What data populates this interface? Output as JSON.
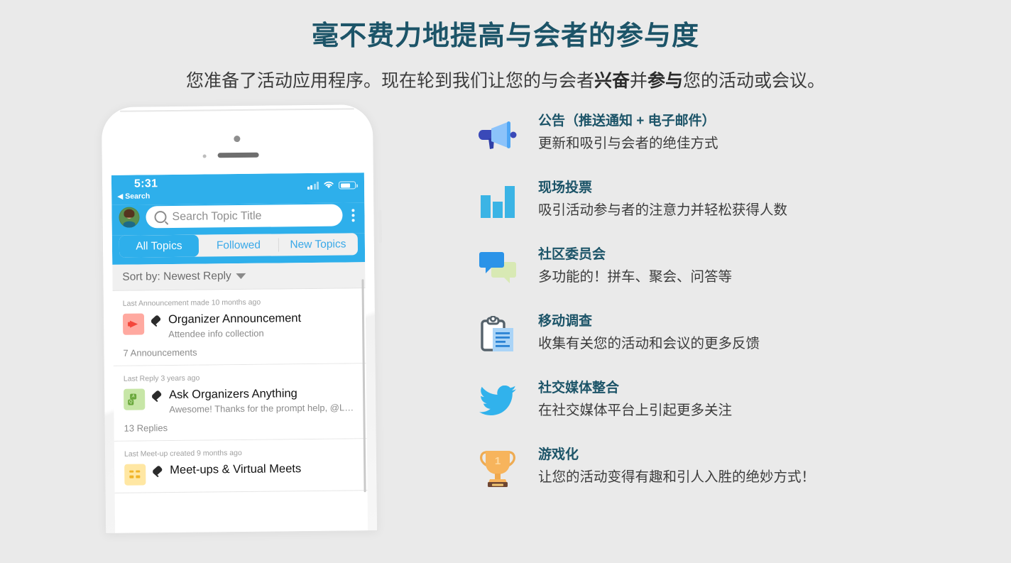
{
  "header": {
    "title": "毫不费力地提高与会者的参与度",
    "subtitle_part1": "您准备了活动应用程序。现在轮到我们让您的与会者",
    "subtitle_bold1": "兴奋",
    "subtitle_part2": "并",
    "subtitle_bold2": "参与",
    "subtitle_part3": "您的活动或会议。",
    "title_color": "#1c5468"
  },
  "phone": {
    "status": {
      "time": "5:31",
      "back_label": "◀ Search",
      "signal_icon": "signal-bars-icon",
      "wifi_icon": "wifi-icon",
      "battery_icon": "battery-icon"
    },
    "nav": {
      "avatar_name": "user-avatar",
      "search_placeholder": "Search Topic Title",
      "search_icon": "search-icon",
      "menu_icon": "kebab-menu-icon"
    },
    "tabs": [
      {
        "label": "All Topics",
        "active": true
      },
      {
        "label": "Followed",
        "active": false
      },
      {
        "label": "New Topics",
        "active": false
      }
    ],
    "sort": {
      "label": "Sort by: Newest Reply",
      "caret_icon": "chevron-down-icon"
    },
    "topics": [
      {
        "meta": "Last Announcement made 10 months ago",
        "title": "Organizer Announcement",
        "subtitle": "Attendee info collection",
        "count": "7 Announcements",
        "badge_icon": "megaphone-badge-icon",
        "badge_color": "#ffa9a0",
        "pin_icon": "pin-icon"
      },
      {
        "meta": "Last Reply 3 years ago",
        "title": "Ask Organizers Anything",
        "subtitle": "Awesome! Thanks for the prompt help, @Lo...",
        "count": "13 Replies",
        "badge_icon": "qa-badge-icon",
        "badge_color": "#c7e6a7",
        "pin_icon": "pin-icon"
      },
      {
        "meta": "Last Meet-up created 9 months ago",
        "title": "Meet-ups & Virtual Meets",
        "subtitle": "",
        "count": "",
        "badge_icon": "grid-badge-icon",
        "badge_color": "#ffe7a3",
        "pin_icon": "pin-icon"
      }
    ],
    "accent_color": "#2EAFEB"
  },
  "features": [
    {
      "icon": "megaphone-icon",
      "title": "公告（推送通知 + 电子邮件）",
      "desc": "更新和吸引与会者的绝佳方式"
    },
    {
      "icon": "bar-chart-icon",
      "title": "现场投票",
      "desc": "吸引活动参与者的注意力并轻松获得人数"
    },
    {
      "icon": "chat-bubbles-icon",
      "title": "社区委员会",
      "desc": "多功能的！拼车、聚会、问答等"
    },
    {
      "icon": "clipboard-icon",
      "title": "移动调查",
      "desc": "收集有关您的活动和会议的更多反馈"
    },
    {
      "icon": "twitter-bird-icon",
      "title": "社交媒体整合",
      "desc": "在社交媒体平台上引起更多关注"
    },
    {
      "icon": "trophy-icon",
      "title": "游戏化",
      "desc": "让您的活动变得有趣和引人入胜的绝妙方式！"
    }
  ]
}
